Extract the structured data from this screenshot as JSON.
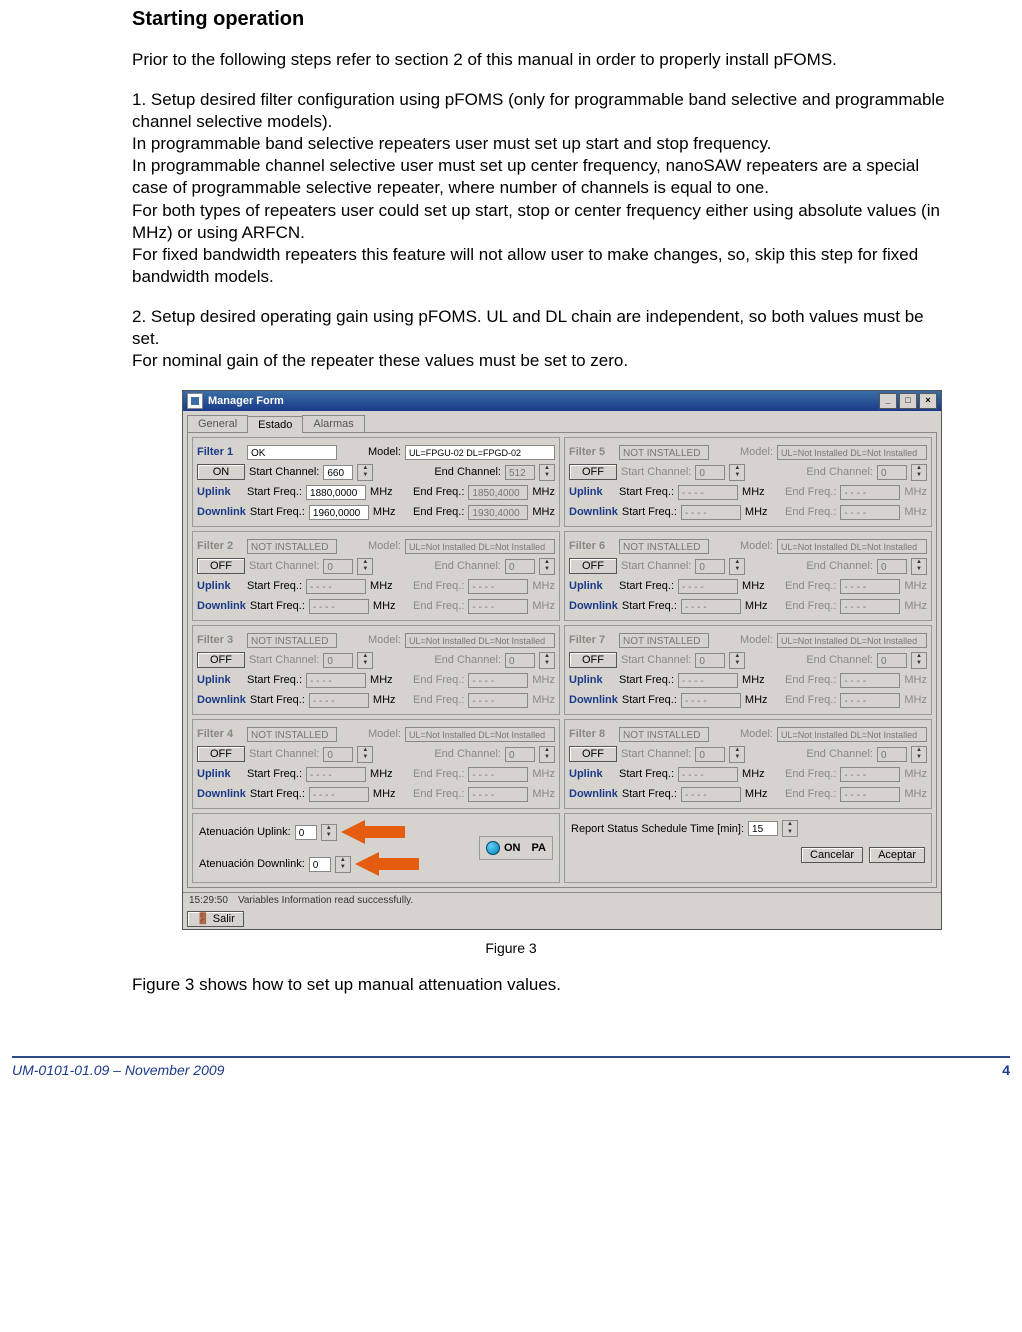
{
  "heading": "Starting operation",
  "para_intro": "Prior to the following steps refer to section 2 of this manual in order to properly install pFOMS.",
  "para1a": "1. Setup desired filter configuration using pFOMS (only for programmable band selective and programmable channel selective models).",
  "para1b": "In programmable band selective repeaters user must set up start and stop frequency.",
  "para1c": "In programmable channel selective user must set up center frequency, nanoSAW repeaters are a special case of programmable selective repeater, where number of channels is equal to one.",
  "para1d": "For both types of repeaters user could set up start, stop or center frequency either using absolute values (in MHz) or using ARFCN.",
  "para1e": "For fixed bandwidth repeaters this feature will not allow user to make changes, so, skip this step for fixed bandwidth models.",
  "para2a": "2. Setup desired operating gain using pFOMS. UL and DL chain are independent, so both values must be set.",
  "para2b": "For nominal gain of the repeater these values must be set to zero.",
  "figure_caption": "Figure 3",
  "para_after_fig": "Figure 3 shows how to set up manual attenuation values.",
  "footer_left": "UM-0101-01.09 – November 2009",
  "footer_right": "4",
  "win": {
    "title": "Manager Form",
    "tabs": {
      "general": "General",
      "estado": "Estado",
      "alarmas": "Alarmas"
    },
    "labels": {
      "filter": "Filter",
      "model": "Model:",
      "start_channel": "Start Channel:",
      "end_channel": "End Channel:",
      "uplink": "Uplink",
      "downlink": "Downlink",
      "start_freq": "Start Freq.:",
      "end_freq": "End Freq.:",
      "mhz": "MHz",
      "att_ul": "Atenuación Uplink:",
      "att_dl": "Atenuación Downlink:",
      "on": "ON",
      "pa": "PA",
      "report": "Report Status Schedule Time [min]:",
      "cancelar": "Cancelar",
      "aceptar": "Aceptar",
      "salir": "Salir",
      "off": "OFF"
    },
    "filters": [
      {
        "name": "Filter 1",
        "status": "OK",
        "model": "UL=FPGU-02  DL=FPGD-02",
        "on": "ON",
        "start_ch": "660",
        "end_ch": "512",
        "ul_start": "1880,0000",
        "ul_end": "1850,4000",
        "dl_start": "1960,0000",
        "dl_end": "1930,4000",
        "active": true
      },
      {
        "name": "Filter 5",
        "status": "NOT INSTALLED",
        "model": "UL=Not Installed  DL=Not Installed",
        "on": "OFF",
        "start_ch": "0",
        "end_ch": "0",
        "ul_start": "- - - -",
        "ul_end": "- - - -",
        "dl_start": "- - - -",
        "dl_end": "- - - -",
        "active": false
      },
      {
        "name": "Filter 2",
        "status": "NOT INSTALLED",
        "model": "UL=Not Installed  DL=Not Installed",
        "on": "OFF",
        "start_ch": "0",
        "end_ch": "0",
        "ul_start": "- - - -",
        "ul_end": "- - - -",
        "dl_start": "- - - -",
        "dl_end": "- - - -",
        "active": false
      },
      {
        "name": "Filter 6",
        "status": "NOT INSTALLED",
        "model": "UL=Not Installed  DL=Not Installed",
        "on": "OFF",
        "start_ch": "0",
        "end_ch": "0",
        "ul_start": "- - - -",
        "ul_end": "- - - -",
        "dl_start": "- - - -",
        "dl_end": "- - - -",
        "active": false
      },
      {
        "name": "Filter 3",
        "status": "NOT INSTALLED",
        "model": "UL=Not Installed  DL=Not Installed",
        "on": "OFF",
        "start_ch": "0",
        "end_ch": "0",
        "ul_start": "- - - -",
        "ul_end": "- - - -",
        "dl_start": "- - - -",
        "dl_end": "- - - -",
        "active": false
      },
      {
        "name": "Filter 7",
        "status": "NOT INSTALLED",
        "model": "UL=Not Installed  DL=Not Installed",
        "on": "OFF",
        "start_ch": "0",
        "end_ch": "0",
        "ul_start": "- - - -",
        "ul_end": "- - - -",
        "dl_start": "- - - -",
        "dl_end": "- - - -",
        "active": false
      },
      {
        "name": "Filter 4",
        "status": "NOT INSTALLED",
        "model": "UL=Not Installed  DL=Not Installed",
        "on": "OFF",
        "start_ch": "0",
        "end_ch": "0",
        "ul_start": "- - - -",
        "ul_end": "- - - -",
        "dl_start": "- - - -",
        "dl_end": "- - - -",
        "active": false
      },
      {
        "name": "Filter 8",
        "status": "NOT INSTALLED",
        "model": "UL=Not Installed  DL=Not Installed",
        "on": "OFF",
        "start_ch": "0",
        "end_ch": "0",
        "ul_start": "- - - -",
        "ul_end": "- - - -",
        "dl_start": "- - - -",
        "dl_end": "- - - -",
        "active": false
      }
    ],
    "att_ul_val": "0",
    "att_dl_val": "0",
    "report_val": "15",
    "status_time": "15:29:50",
    "status_msg": "Variables Information read successfully."
  }
}
